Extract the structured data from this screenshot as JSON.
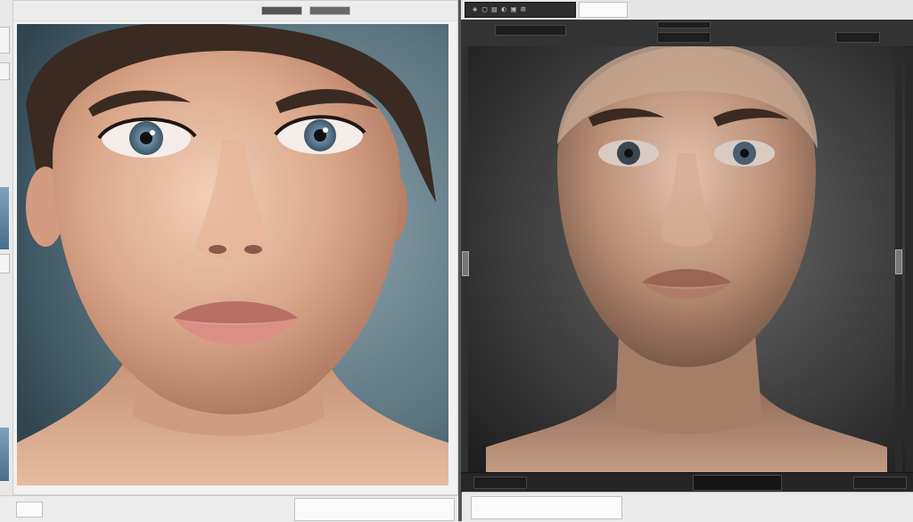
{
  "left_window": {
    "toolbar_field_1": "",
    "toolbar_field_2": ""
  },
  "right_editor": {
    "tab_label": "",
    "status_text": ""
  },
  "icons": [
    "minimize-icon",
    "close-icon",
    "tool-icons",
    "scroll-handle-icon"
  ],
  "colors": {
    "left_photo_bg": "#4f6b79",
    "right_photo_bg": "#3a3a3a",
    "skin_light": "#e2b59a",
    "skin_dark": "#a9826a"
  }
}
